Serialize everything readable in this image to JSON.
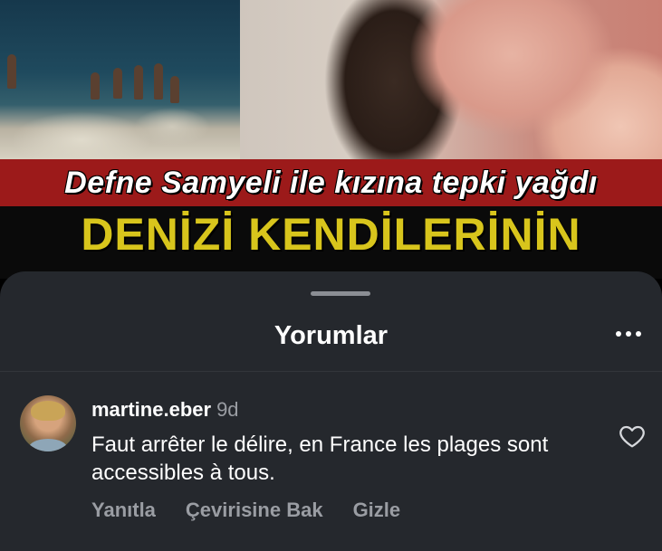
{
  "video": {
    "headline_red": "Defne Samyeli ile kızına tepki yağdı",
    "headline_yellow": "DENİZİ KENDİLERİNİN"
  },
  "sheet": {
    "title": "Yorumlar",
    "more_icon": "more-horizontal-icon"
  },
  "comment": {
    "username": "martine.eber",
    "time": "9d",
    "text": "Faut arrêter le délire, en France les plages sont accessibles à tous.",
    "like_icon": "heart-outline-icon",
    "actions": {
      "reply": "Yanıtla",
      "translate": "Çevirisine Bak",
      "hide": "Gizle"
    }
  },
  "colors": {
    "sheet_bg": "#25282d",
    "banner_red": "#9c1a1a",
    "headline_yellow": "#d8c51c",
    "muted_text": "#9a9da3"
  }
}
